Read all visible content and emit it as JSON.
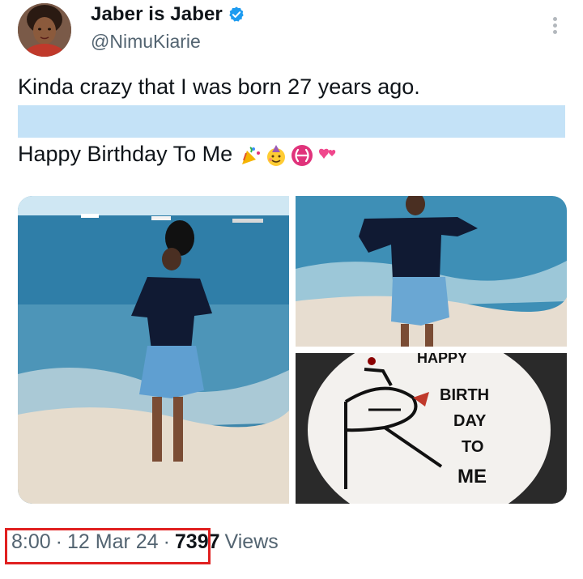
{
  "tweet": {
    "display_name": "Jaber is Jaber",
    "handle": "@NimuKiarie",
    "line1": "Kinda crazy that I was born 27 years ago.",
    "line2": "Happy Birthday To Me",
    "emoji_icons": [
      "party-popper-icon",
      "partying-face-icon",
      "pisces-icon",
      "two-hearts-icon"
    ],
    "time": "8:00",
    "date": "12 Mar 24",
    "views_count": "7397",
    "views_label": "Views"
  },
  "cake": {
    "lines": [
      "HAPPY",
      "BIRTH",
      "DAY",
      "TO",
      "ME"
    ]
  },
  "colors": {
    "verified": "#1d9bf0",
    "highlight": "#c4e2f7",
    "annotation_box": "#e02020",
    "secondary_text": "#536471"
  }
}
